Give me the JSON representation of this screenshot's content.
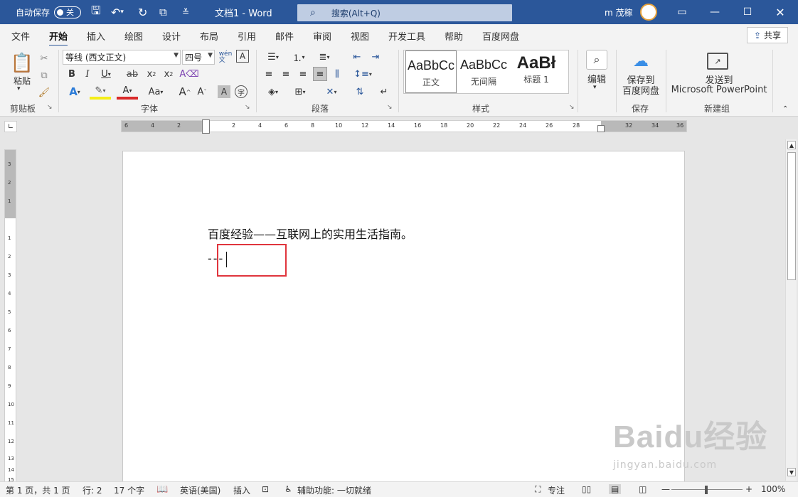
{
  "titlebar": {
    "autosave_label": "自动保存",
    "autosave_state": "关",
    "doc_title": "文档1  -  Word",
    "search_placeholder": "搜索(Alt+Q)",
    "user_name": "m 茂稼"
  },
  "tabs": [
    "文件",
    "开始",
    "插入",
    "绘图",
    "设计",
    "布局",
    "引用",
    "邮件",
    "审阅",
    "视图",
    "开发工具",
    "帮助",
    "百度网盘"
  ],
  "active_tab": "开始",
  "share_label": "共享",
  "ribbon": {
    "clipboard": {
      "paste_label": "粘贴",
      "group_label": "剪贴板"
    },
    "font": {
      "font_name": "等线 (西文正文)",
      "font_size": "四号",
      "group_label": "字体"
    },
    "paragraph": {
      "group_label": "段落"
    },
    "styles": {
      "items": [
        {
          "preview": "AaBbCc",
          "name": "正文"
        },
        {
          "preview": "AaBbCc",
          "name": "无间隔"
        },
        {
          "preview": "AaBł",
          "name": "标题 1"
        }
      ],
      "group_label": "样式"
    },
    "editing": {
      "label": "编辑"
    },
    "save": {
      "label_line1": "保存到",
      "label_line2": "百度网盘",
      "group_label": "保存"
    },
    "newgroup": {
      "label_line1": "发送到",
      "label_line2": "Microsoft PowerPoint",
      "group_label": "新建组"
    }
  },
  "ruler_numbers": [
    "6",
    "4",
    "2",
    "2",
    "4",
    "6",
    "8",
    "10",
    "12",
    "14",
    "16",
    "18",
    "20",
    "22",
    "24",
    "26",
    "28",
    "32",
    "34",
    "36"
  ],
  "vruler_numbers": [
    "3",
    "2",
    "1",
    "1",
    "2",
    "3",
    "4",
    "5",
    "6",
    "7",
    "8",
    "9",
    "10",
    "11",
    "12",
    "13",
    "14",
    "15"
  ],
  "document": {
    "line1": "百度经验——互联网上的实用生活指南。",
    "line2": "---"
  },
  "statusbar": {
    "page": "第 1 页，共 1 页",
    "line": "行: 2",
    "words": "17 个字",
    "language": "英语(美国)",
    "mode": "插入",
    "accessibility": "辅助功能: 一切就绪",
    "focus": "专注",
    "zoom": "100%"
  },
  "watermark": {
    "brand": "Baidu经验",
    "url": "jingyan.baidu.com"
  },
  "colors": {
    "titlebar": "#2b579a",
    "highlight_box": "#e0353d"
  }
}
